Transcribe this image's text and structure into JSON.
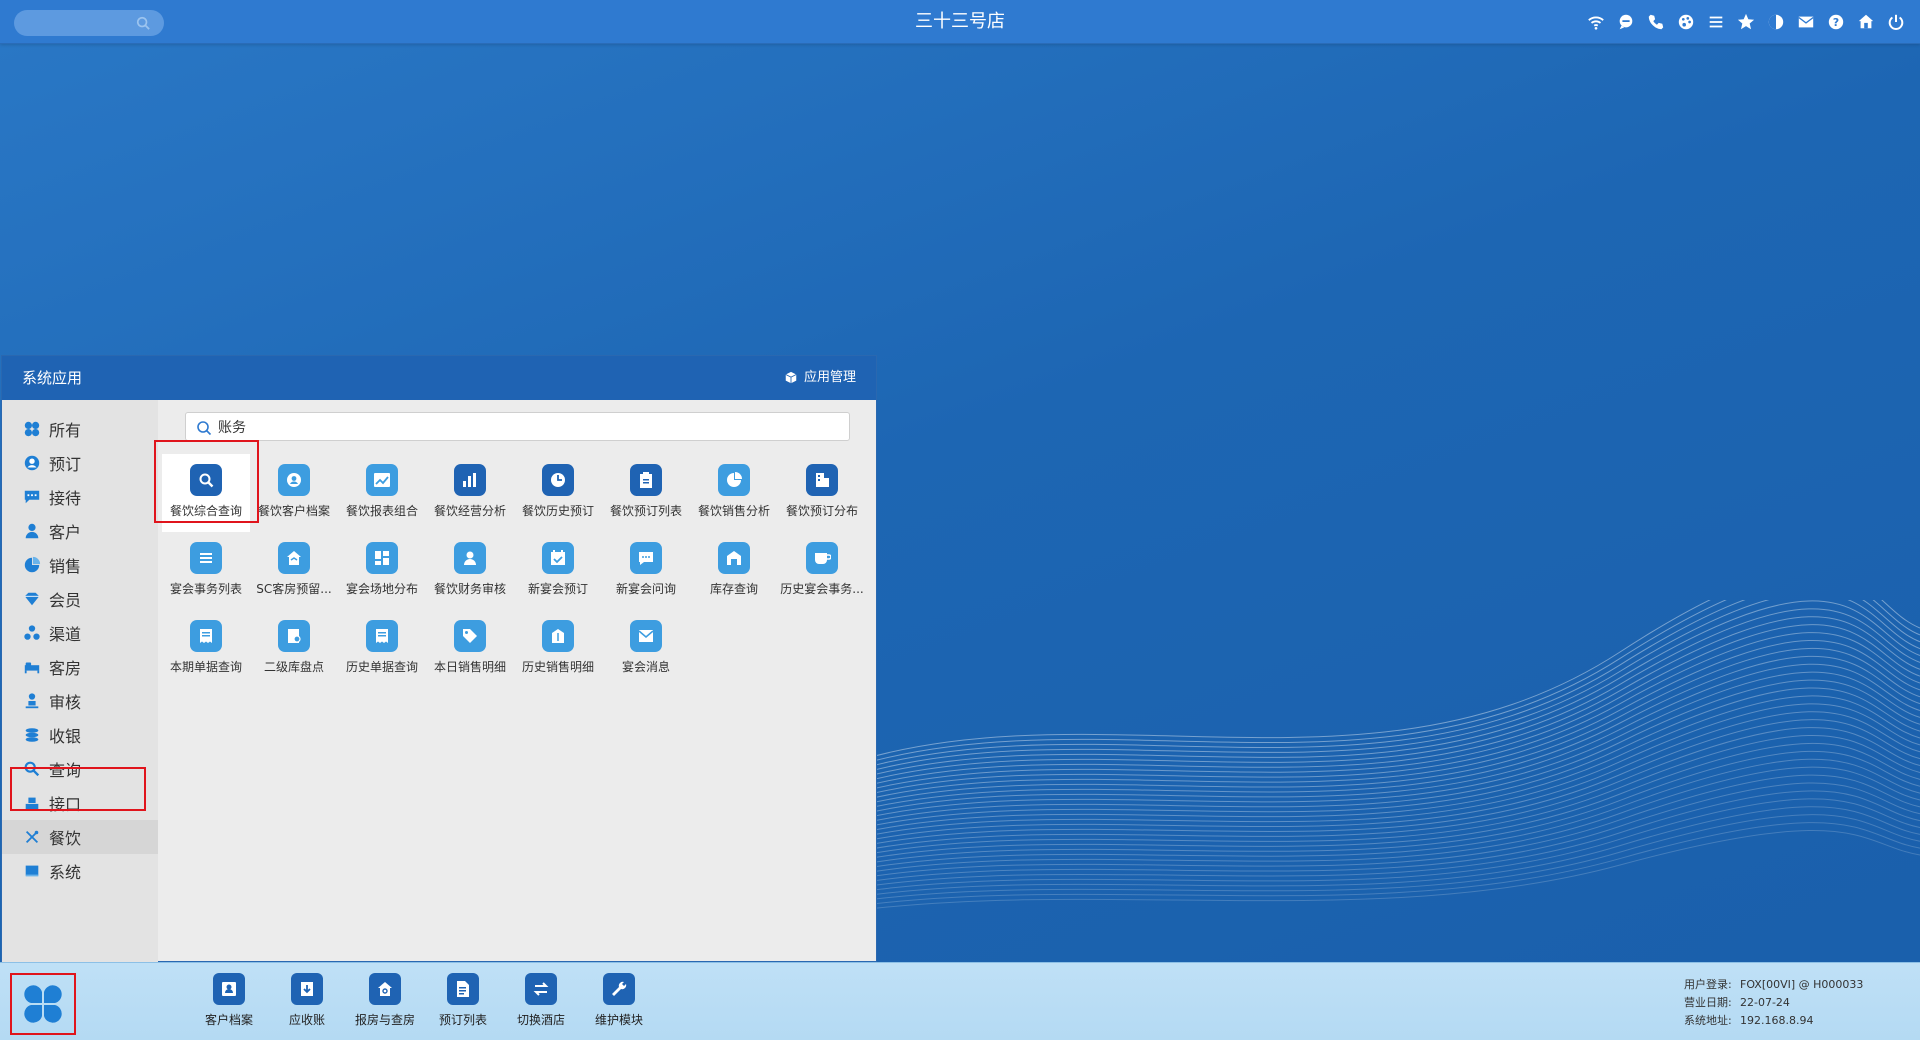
{
  "topbar": {
    "title": "三十三号店",
    "search_placeholder": "",
    "icons": [
      "wifi-icon",
      "chat-icon",
      "phone-icon",
      "palette-icon",
      "menu-lines-icon",
      "star-icon",
      "contrast-icon",
      "mail-icon",
      "help-icon",
      "home-icon",
      "power-icon"
    ]
  },
  "panel": {
    "title": "系统应用",
    "manage_label": "应用管理",
    "search": {
      "value": "账务",
      "placeholder": ""
    },
    "sidebar": [
      {
        "label": "所有",
        "icon": "apps-icon"
      },
      {
        "label": "预订",
        "icon": "account-circle-icon"
      },
      {
        "label": "接待",
        "icon": "message-icon"
      },
      {
        "label": "客户",
        "icon": "person-icon"
      },
      {
        "label": "销售",
        "icon": "pie-icon"
      },
      {
        "label": "会员",
        "icon": "diamond-icon"
      },
      {
        "label": "渠道",
        "icon": "channel-icon"
      },
      {
        "label": "客房",
        "icon": "bed-icon"
      },
      {
        "label": "审核",
        "icon": "audit-person-icon"
      },
      {
        "label": "收银",
        "icon": "coins-icon"
      },
      {
        "label": "查询",
        "icon": "search-icon"
      },
      {
        "label": "接口",
        "icon": "interface-icon"
      },
      {
        "label": "餐饮",
        "icon": "cutlery-icon"
      },
      {
        "label": "系统",
        "icon": "system-icon"
      }
    ],
    "sidebar_active": "餐饮",
    "apps": [
      {
        "label": "餐饮综合查询",
        "icon": "search-icon"
      },
      {
        "label": "餐饮客户档案",
        "icon": "customer-icon"
      },
      {
        "label": "餐饮报表组合",
        "icon": "trend-icon"
      },
      {
        "label": "餐饮经营分析",
        "icon": "bar-chart-icon"
      },
      {
        "label": "餐饮历史预订",
        "icon": "clock-icon"
      },
      {
        "label": "餐饮预订列表",
        "icon": "clipboard-icon"
      },
      {
        "label": "餐饮销售分析",
        "icon": "pie-icon"
      },
      {
        "label": "餐饮预订分布",
        "icon": "building-icon"
      },
      {
        "label": "宴会事务列表",
        "icon": "list-icon"
      },
      {
        "label": "SC客房预留...",
        "icon": "house-icon"
      },
      {
        "label": "宴会场地分布",
        "icon": "dashboard-icon"
      },
      {
        "label": "餐饮财务审核",
        "icon": "user-check-icon"
      },
      {
        "label": "新宴会预订",
        "icon": "calendar-check-icon"
      },
      {
        "label": "新宴会问询",
        "icon": "chat-icon"
      },
      {
        "label": "库存查询",
        "icon": "warehouse-icon"
      },
      {
        "label": "历史宴会事务...",
        "icon": "cup-icon"
      },
      {
        "label": "本期单据查询",
        "icon": "receipt-icon"
      },
      {
        "label": "二级库盘点",
        "icon": "inventory-icon"
      },
      {
        "label": "历史单据查询",
        "icon": "receipt-icon"
      },
      {
        "label": "本日销售明细",
        "icon": "tag-icon"
      },
      {
        "label": "历史销售明细",
        "icon": "label-icon"
      },
      {
        "label": "宴会消息",
        "icon": "mail-icon"
      }
    ],
    "selected_app": "餐饮综合查询"
  },
  "taskbar": {
    "start_icon": "start-flower-icon",
    "items": [
      {
        "label": "客户档案",
        "icon": "customer-card-icon"
      },
      {
        "label": "应收账",
        "icon": "download-icon"
      },
      {
        "label": "报房与查房",
        "icon": "house-search-icon"
      },
      {
        "label": "预订列表",
        "icon": "doc-list-icon"
      },
      {
        "label": "切换酒店",
        "icon": "switch-icon"
      },
      {
        "label": "维护模块",
        "icon": "wrench-icon"
      }
    ],
    "sysinfo": [
      {
        "key": "用户登录:",
        "value": "FOX[00VI] @ H000033"
      },
      {
        "key": "营业日期:",
        "value": "22-07-24"
      },
      {
        "key": "系统地址:",
        "value": "192.168.8.94"
      }
    ]
  },
  "colors": {
    "desktop": "#1d66b3",
    "topbar": "#2f7ad0",
    "panel_header": "#1f63b3",
    "app_icon_dark": "#1f63b3",
    "app_icon_light": "#3d9de0",
    "highlight_red": "#e0141c",
    "taskbar": "#b8dbf4"
  }
}
